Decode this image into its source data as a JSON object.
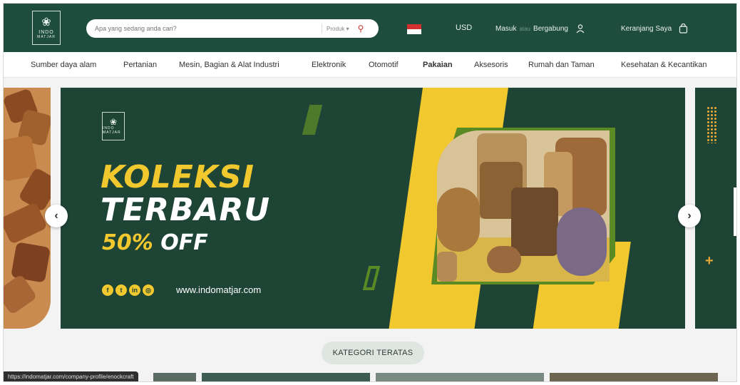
{
  "header": {
    "logo": {
      "line1": "INDO",
      "line2": "MATJAR"
    },
    "search": {
      "placeholder": "Apa yang sedang anda cari?",
      "category_select": "Produk ▾"
    },
    "currency": "USD",
    "auth": {
      "login": "Masuk",
      "or": "atau",
      "register": "Bergabung"
    },
    "cart_label": "Keranjang Saya"
  },
  "categories": [
    "Sumber daya alam",
    "Pertanian",
    "Mesin, Bagian & Alat Industri",
    "Elektronik",
    "Otomotif",
    "Pakaian",
    "Aksesoris",
    "Rumah dan Taman",
    "Kesehatan & Kecantikan"
  ],
  "banner": {
    "logo_text": "INDO MATJAR",
    "headline1": "KOLEKSI",
    "headline2": "TERBARU",
    "discount_pct": "50%",
    "discount_off": "OFF",
    "social_icons": [
      "facebook-icon",
      "twitter-icon",
      "linkedin-icon",
      "instagram-icon"
    ],
    "website": "www.indomatjar.com"
  },
  "section_button": "KATEGORI TERATAS",
  "status_url": "https://indomatjar.com/company-profile/enockcraft",
  "colors": {
    "primary": "#1f4d3d",
    "accent": "#f1c82e",
    "banner_bg": "#1e4436"
  }
}
